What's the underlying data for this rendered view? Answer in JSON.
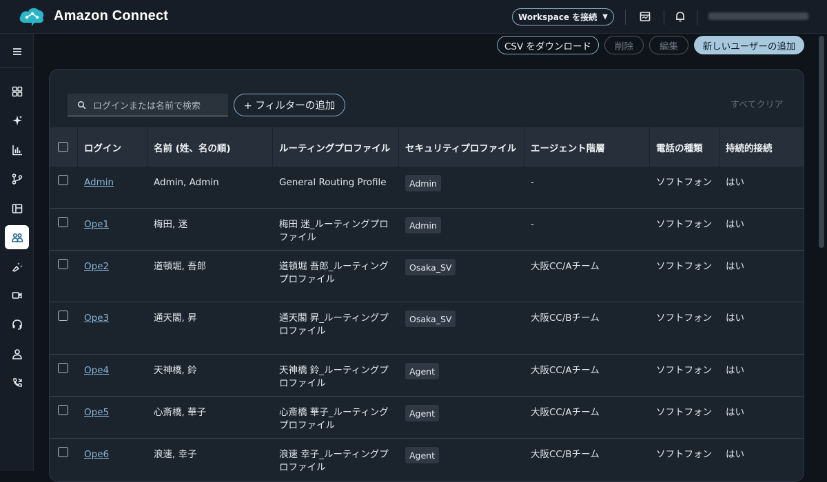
{
  "app": {
    "title": "Amazon Connect"
  },
  "header": {
    "workspace_button": "Workspace を接続",
    "caret": "▼"
  },
  "actions": {
    "download_csv": "CSV をダウンロード",
    "delete": "削除",
    "edit": "編集",
    "add_user": "新しいユーザーの追加"
  },
  "search": {
    "placeholder": "ログインまたは名前で検索"
  },
  "filter": {
    "add_label": "+ フィルターの追加",
    "clear_all": "すべてクリア"
  },
  "table": {
    "headers": [
      "ログイン",
      "名前 (姓、名の順)",
      "ルーティングプロファイル",
      "セキュリティプロファイル",
      "エージェント階層",
      "電話の種類",
      "持続的接続"
    ],
    "rows": [
      {
        "login": "Admin",
        "name": "Admin, Admin",
        "routing": [
          "General Routing Profile"
        ],
        "security": "Admin",
        "hierarchy": "-",
        "phone": "ソフトフォン",
        "persistent": "はい"
      },
      {
        "login": "Ope1",
        "name": "梅田, 迷",
        "routing": [
          "梅田 迷_ルーティングプロ",
          "ファイル"
        ],
        "security": "Admin",
        "hierarchy": "-",
        "phone": "ソフトフォン",
        "persistent": "はい"
      },
      {
        "login": "Ope2",
        "name": "道頓堀, 吾郎",
        "routing": [
          "道頓堀 吾郎_ルーティング",
          "プロファイル"
        ],
        "security": "Osaka_SV",
        "hierarchy": "大阪CC/Aチーム",
        "phone": "ソフトフォン",
        "persistent": "はい"
      },
      {
        "login": "Ope3",
        "name": "通天閣, 昇",
        "routing": [
          "通天閣 昇_ルーティングプ",
          "ロファイル"
        ],
        "security": "Osaka_SV",
        "hierarchy": "大阪CC/Bチーム",
        "phone": "ソフトフォン",
        "persistent": "はい"
      },
      {
        "login": "Ope4",
        "name": "天神橋, 鈴",
        "routing": [
          "天神橋 鈴_ルーティングプ",
          "ロファイル"
        ],
        "security": "Agent",
        "hierarchy": "大阪CC/Aチーム",
        "phone": "ソフトフォン",
        "persistent": "はい"
      },
      {
        "login": "Ope5",
        "name": "心斎橋, 華子",
        "routing": [
          "心斎橋 華子_ルーティング",
          "プロファイル"
        ],
        "security": "Agent",
        "hierarchy": "大阪CC/Aチーム",
        "phone": "ソフトフォン",
        "persistent": "はい"
      },
      {
        "login": "Ope6",
        "name": "浪速, 幸子",
        "routing": [
          "浪速 幸子_ルーティングプ",
          "ロファイル"
        ],
        "security": "Agent",
        "hierarchy": "大阪CC/Bチーム",
        "phone": "ソフトフォン",
        "persistent": "はい"
      }
    ]
  },
  "sidebar": {
    "items": [
      "menu-icon",
      "dashboard-icon",
      "sparkle-icon",
      "analytics-icon",
      "routing-icon",
      "channels-icon",
      "users-icon",
      "agent-apps-icon",
      "integrations-icon",
      "headset-icon",
      "profile-icon",
      "phone-icon"
    ]
  },
  "colors": {
    "accent": "#8ab0c8",
    "link": "#89b4d4",
    "primary_button": "#a8c8dd",
    "background": "#0f141a"
  }
}
